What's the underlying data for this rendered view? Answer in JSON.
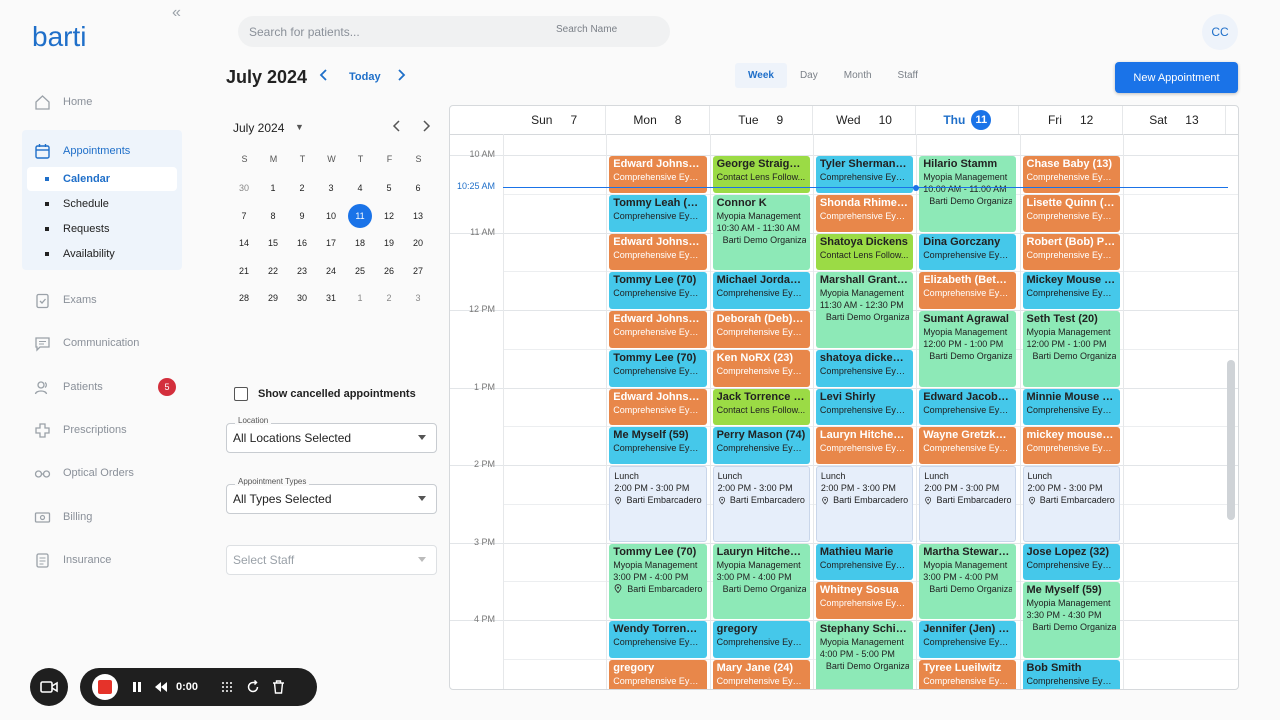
{
  "brand": {
    "logo_text": "barti",
    "accent": "#1a73e8"
  },
  "sidebar": {
    "collapse_icon": "double-chevron-left-icon",
    "items": [
      {
        "label": "Home",
        "icon": "home-icon"
      },
      {
        "label": "Appointments",
        "icon": "calendar-icon"
      },
      {
        "label": "Exams",
        "icon": "clipboard-icon"
      },
      {
        "label": "Communication",
        "icon": "chat-icon"
      },
      {
        "label": "Patients",
        "icon": "people-icon",
        "badge": "5"
      },
      {
        "label": "Prescriptions",
        "icon": "cross-icon"
      },
      {
        "label": "Optical Orders",
        "icon": "glasses-icon"
      },
      {
        "label": "Billing",
        "icon": "money-icon"
      },
      {
        "label": "Insurance",
        "icon": "document-icon"
      }
    ],
    "sub_items": [
      "Calendar",
      "Schedule",
      "Requests",
      "Availability"
    ]
  },
  "search": {
    "placeholder": "Search for patients...",
    "mode": "Search Name"
  },
  "user": {
    "initials": "CC"
  },
  "header": {
    "title": "July 2024",
    "today": "Today",
    "views": [
      "Week",
      "Day",
      "Month",
      "Staff"
    ],
    "new_appointment": "New Appointment"
  },
  "mini_calendar": {
    "title": "July 2024",
    "dow": [
      "S",
      "M",
      "T",
      "W",
      "T",
      "F",
      "S"
    ],
    "weeks": [
      [
        "30",
        "1",
        "2",
        "3",
        "4",
        "5",
        "6"
      ],
      [
        "7",
        "8",
        "9",
        "10",
        "11",
        "12",
        "13"
      ],
      [
        "14",
        "15",
        "16",
        "17",
        "18",
        "19",
        "20"
      ],
      [
        "21",
        "22",
        "23",
        "24",
        "25",
        "26",
        "27"
      ],
      [
        "28",
        "29",
        "30",
        "31",
        "1",
        "2",
        "3"
      ]
    ],
    "selected": "11"
  },
  "filters": {
    "show_cancelled": "Show cancelled appointments",
    "location_label": "Location",
    "location_value": "All Locations Selected",
    "types_label": "Appointment Types",
    "types_value": "All Types Selected",
    "staff_placeholder": "Select Staff"
  },
  "week": {
    "days": [
      [
        "Sun",
        "7"
      ],
      [
        "Mon",
        "8"
      ],
      [
        "Tue",
        "9"
      ],
      [
        "Wed",
        "10"
      ],
      [
        "Thu",
        "11"
      ],
      [
        "Fri",
        "12"
      ],
      [
        "Sat",
        "13"
      ]
    ],
    "today_index": 4,
    "time_labels": [
      "10 AM",
      "11 AM",
      "12 PM",
      "1 PM",
      "2 PM",
      "3 PM",
      "4 PM"
    ],
    "now_label": "10:25 AM",
    "colors": {
      "orange": "#e8874a",
      "cyan": "#45c8ea",
      "lime": "#9bdb45",
      "mint": "#8de9b7",
      "lunch": "#e6eefa"
    }
  },
  "events": [
    {
      "d": 1,
      "r": 0,
      "h": 1,
      "c": "orange",
      "t": "Edward Johnson...",
      "s": [
        "Comprehensive Eye ..."
      ]
    },
    {
      "d": 1,
      "r": 1,
      "h": 1,
      "c": "cyan",
      "t": "Tommy Leah (70)",
      "s": [
        "Comprehensive Eye ..."
      ]
    },
    {
      "d": 1,
      "r": 2,
      "h": 1,
      "c": "orange",
      "t": "Edward Johnson...",
      "s": [
        "Comprehensive Eye ..."
      ]
    },
    {
      "d": 1,
      "r": 3,
      "h": 1,
      "c": "cyan",
      "t": "Tommy Lee (70)",
      "s": [
        "Comprehensive Eye ..."
      ]
    },
    {
      "d": 1,
      "r": 4,
      "h": 1,
      "c": "orange",
      "t": "Edward Johnson...",
      "s": [
        "Comprehensive Eye ..."
      ]
    },
    {
      "d": 1,
      "r": 5,
      "h": 1,
      "c": "cyan",
      "t": "Tommy Lee (70)",
      "s": [
        "Comprehensive Eye ..."
      ]
    },
    {
      "d": 1,
      "r": 6,
      "h": 1,
      "c": "orange",
      "t": "Edward Johnson...",
      "s": [
        "Comprehensive Eye ..."
      ]
    },
    {
      "d": 1,
      "r": 7,
      "h": 1,
      "c": "cyan",
      "t": "Me Myself (59)",
      "s": [
        "Comprehensive Eye ..."
      ]
    },
    {
      "d": 1,
      "r": 8,
      "h": 2,
      "c": "lunch",
      "t": "Lunch",
      "s": [
        "2:00 PM - 3:00 PM"
      ],
      "loc": "Barti Embarcadero"
    },
    {
      "d": 1,
      "r": 10,
      "h": 2,
      "c": "mint",
      "t": "Tommy Lee (70)",
      "s": [
        "Myopia Management",
        "3:00 PM - 4:00 PM"
      ],
      "loc": "Barti Embarcadero"
    },
    {
      "d": 1,
      "r": 12,
      "h": 1,
      "c": "cyan",
      "t": "Wendy Torrence ...",
      "s": [
        "Comprehensive Eye ..."
      ]
    },
    {
      "d": 1,
      "r": 13,
      "h": 1,
      "c": "orange",
      "t": "gregory",
      "s": [
        "Comprehensive Eye ..."
      ]
    },
    {
      "d": 2,
      "r": 0,
      "h": 1,
      "c": "lime",
      "t": "George Straight ...",
      "s": [
        "Contact Lens Follow..."
      ]
    },
    {
      "d": 2,
      "r": 1,
      "h": 2,
      "c": "mint",
      "t": "Connor K",
      "s": [
        "Myopia Management",
        "10:30 AM - 11:30 AM"
      ],
      "loc": "Barti Demo Organizat"
    },
    {
      "d": 2,
      "r": 3,
      "h": 1,
      "c": "cyan",
      "t": "Michael Jordan (...",
      "s": [
        "Comprehensive Eye ..."
      ]
    },
    {
      "d": 2,
      "r": 4,
      "h": 1,
      "c": "orange",
      "t": "Deborah (Deb) Zi...",
      "s": [
        "Comprehensive Eye ..."
      ]
    },
    {
      "d": 2,
      "r": 5,
      "h": 1,
      "c": "orange",
      "t": "Ken NoRX (23)",
      "s": [
        "Comprehensive Eye ..."
      ]
    },
    {
      "d": 2,
      "r": 6,
      "h": 1,
      "c": "lime",
      "t": "Jack Torrence (8...",
      "s": [
        "Contact Lens Follow..."
      ]
    },
    {
      "d": 2,
      "r": 7,
      "h": 1,
      "c": "cyan",
      "t": "Perry Mason (74)",
      "s": [
        "Comprehensive Eye ..."
      ]
    },
    {
      "d": 2,
      "r": 8,
      "h": 2,
      "c": "lunch",
      "t": "Lunch",
      "s": [
        "2:00 PM - 3:00 PM"
      ],
      "loc": "Barti Embarcadero"
    },
    {
      "d": 2,
      "r": 10,
      "h": 2,
      "c": "mint",
      "t": "Lauryn Hitchens ...",
      "s": [
        "Myopia Management",
        "3:00 PM - 4:00 PM"
      ],
      "loc": "Barti Demo Organizat"
    },
    {
      "d": 2,
      "r": 12,
      "h": 1,
      "c": "cyan",
      "t": "gregory",
      "s": [
        "Comprehensive Eye ..."
      ]
    },
    {
      "d": 2,
      "r": 13,
      "h": 1,
      "c": "orange",
      "t": "Mary Jane (24)",
      "s": [
        "Comprehensive Eye ..."
      ]
    },
    {
      "d": 3,
      "r": 0,
      "h": 1,
      "c": "cyan",
      "t": "Tyler Sherman (...",
      "s": [
        "Comprehensive Eye ..."
      ]
    },
    {
      "d": 3,
      "r": 1,
      "h": 1,
      "c": "orange",
      "t": "Shonda Rhimess...",
      "s": [
        "Comprehensive Eye ..."
      ]
    },
    {
      "d": 3,
      "r": 2,
      "h": 1,
      "c": "lime",
      "t": "Shatoya Dickens",
      "s": [
        "Contact Lens Follow..."
      ]
    },
    {
      "d": 3,
      "r": 3,
      "h": 2,
      "c": "mint",
      "t": "Marshall Grant (...",
      "s": [
        "Myopia Management",
        "11:30 AM - 12:30 PM"
      ],
      "loc": "Barti Demo Organizat"
    },
    {
      "d": 3,
      "r": 5,
      "h": 1,
      "c": "cyan",
      "t": "shatoya dickens ...",
      "s": [
        "Comprehensive Eye ..."
      ]
    },
    {
      "d": 3,
      "r": 6,
      "h": 1,
      "c": "cyan",
      "t": "Levi Shirly",
      "s": [
        "Comprehensive Eye ..."
      ]
    },
    {
      "d": 3,
      "r": 7,
      "h": 1,
      "c": "orange",
      "t": "Lauryn Hitchens ...",
      "s": [
        "Comprehensive Eye ..."
      ]
    },
    {
      "d": 3,
      "r": 8,
      "h": 2,
      "c": "lunch",
      "t": "Lunch",
      "s": [
        "2:00 PM - 3:00 PM"
      ],
      "loc": "Barti Embarcadero"
    },
    {
      "d": 3,
      "r": 10,
      "h": 1,
      "c": "cyan",
      "t": "Mathieu Marie",
      "s": [
        "Comprehensive Eye ..."
      ]
    },
    {
      "d": 3,
      "r": 11,
      "h": 1,
      "c": "orange",
      "t": "Whitney Sosua",
      "s": [
        "Comprehensive Eye ..."
      ]
    },
    {
      "d": 3,
      "r": 12,
      "h": 2,
      "c": "mint",
      "t": "Stephany Schiller",
      "s": [
        "Myopia Management",
        "4:00 PM - 5:00 PM"
      ],
      "loc": "Barti Demo Organizat"
    },
    {
      "d": 4,
      "r": 0,
      "h": 2,
      "c": "mint",
      "t": "Hilario Stamm",
      "s": [
        "Myopia Management",
        "10:00 AM - 11:00 AM"
      ],
      "loc": "Barti Demo Organizat"
    },
    {
      "d": 4,
      "r": 2,
      "h": 1,
      "c": "cyan",
      "t": "Dina Gorczany",
      "s": [
        "Comprehensive Eye ..."
      ]
    },
    {
      "d": 4,
      "r": 3,
      "h": 1,
      "c": "orange",
      "t": "Elizabeth (Betsy...",
      "s": [
        "Comprehensive Eye ..."
      ]
    },
    {
      "d": 4,
      "r": 4,
      "h": 2,
      "c": "mint",
      "t": "Sumant Agrawal",
      "s": [
        "Myopia Management",
        "12:00 PM - 1:00 PM"
      ],
      "loc": "Barti Demo Organizat"
    },
    {
      "d": 4,
      "r": 6,
      "h": 1,
      "c": "cyan",
      "t": "Edward Jacobs (...",
      "s": [
        "Comprehensive Eye ..."
      ]
    },
    {
      "d": 4,
      "r": 7,
      "h": 1,
      "c": "orange",
      "t": "Wayne Gretzky (...",
      "s": [
        "Comprehensive Eye ..."
      ]
    },
    {
      "d": 4,
      "r": 8,
      "h": 2,
      "c": "lunch",
      "t": "Lunch",
      "s": [
        "2:00 PM - 3:00 PM"
      ],
      "loc": "Barti Embarcadero"
    },
    {
      "d": 4,
      "r": 10,
      "h": 2,
      "c": "mint",
      "t": "Martha Stewart (...",
      "s": [
        "Myopia Management",
        "3:00 PM - 4:00 PM"
      ],
      "loc": "Barti Demo Organizat"
    },
    {
      "d": 4,
      "r": 12,
      "h": 1,
      "c": "cyan",
      "t": "Jennifer (Jen) W...",
      "s": [
        "Comprehensive Eye ..."
      ]
    },
    {
      "d": 4,
      "r": 13,
      "h": 1,
      "c": "orange",
      "t": "Tyree Lueilwitz",
      "s": [
        "Comprehensive Eye ..."
      ]
    },
    {
      "d": 5,
      "r": 0,
      "h": 1,
      "c": "orange",
      "t": "Chase Baby (13)",
      "s": [
        "Comprehensive Eye ..."
      ]
    },
    {
      "d": 5,
      "r": 1,
      "h": 1,
      "c": "orange",
      "t": "Lisette Quinn (31)",
      "s": [
        "Comprehensive Eye ..."
      ]
    },
    {
      "d": 5,
      "r": 2,
      "h": 1,
      "c": "orange",
      "t": "Robert (Bob) Pa...",
      "s": [
        "Comprehensive Eye ..."
      ]
    },
    {
      "d": 5,
      "r": 3,
      "h": 1,
      "c": "cyan",
      "t": "Mickey Mouse (...",
      "s": [
        "Comprehensive Eye ..."
      ]
    },
    {
      "d": 5,
      "r": 4,
      "h": 2,
      "c": "mint",
      "t": "Seth Test (20)",
      "s": [
        "Myopia Management",
        "12:00 PM - 1:00 PM"
      ],
      "loc": "Barti Demo Organizat"
    },
    {
      "d": 5,
      "r": 6,
      "h": 1,
      "c": "cyan",
      "t": "Minnie Mouse (7...",
      "s": [
        "Comprehensive Eye ..."
      ]
    },
    {
      "d": 5,
      "r": 7,
      "h": 1,
      "c": "orange",
      "t": "mickey mouse (...",
      "s": [
        "Comprehensive Eye ..."
      ]
    },
    {
      "d": 5,
      "r": 8,
      "h": 2,
      "c": "lunch",
      "t": "Lunch",
      "s": [
        "2:00 PM - 3:00 PM"
      ],
      "loc": "Barti Embarcadero"
    },
    {
      "d": 5,
      "r": 10,
      "h": 1,
      "c": "cyan",
      "t": "Jose Lopez (32)",
      "s": [
        "Comprehensive Eye ..."
      ]
    },
    {
      "d": 5,
      "r": 11,
      "h": 2,
      "c": "mint",
      "t": "Me Myself (59)",
      "s": [
        "Myopia Management",
        "3:30 PM - 4:30 PM"
      ],
      "loc": "Barti Demo Organizat"
    },
    {
      "d": 5,
      "r": 13,
      "h": 1,
      "c": "cyan",
      "t": "Bob Smith",
      "s": [
        "Comprehensive Eye ..."
      ]
    }
  ],
  "recorder": {
    "time": "0:00",
    "cam_icon": "video-camera-icon",
    "stop_icon": "stop-icon",
    "pause_icon": "pause-icon",
    "rewind_icon": "rewind-icon",
    "grid_icon": "grid-icon",
    "restart_icon": "restart-icon",
    "trash_icon": "trash-icon"
  }
}
